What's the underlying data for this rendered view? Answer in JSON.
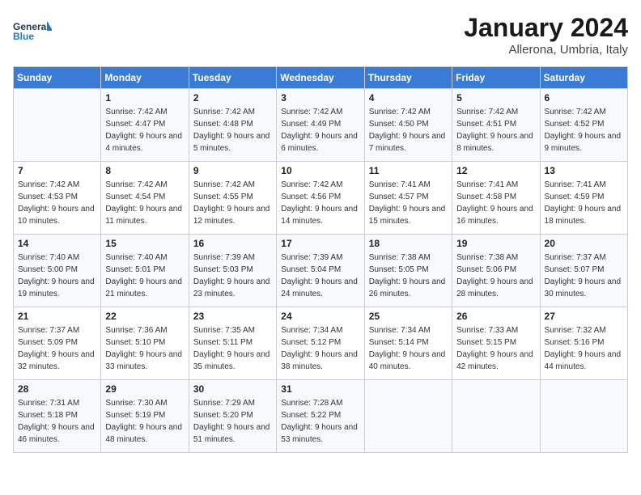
{
  "header": {
    "logo_line1": "General",
    "logo_line2": "Blue",
    "month_year": "January 2024",
    "location": "Allerona, Umbria, Italy"
  },
  "weekdays": [
    "Sunday",
    "Monday",
    "Tuesday",
    "Wednesday",
    "Thursday",
    "Friday",
    "Saturday"
  ],
  "weeks": [
    [
      {
        "day": "",
        "sunrise": "",
        "sunset": "",
        "daylight": ""
      },
      {
        "day": "1",
        "sunrise": "Sunrise: 7:42 AM",
        "sunset": "Sunset: 4:47 PM",
        "daylight": "Daylight: 9 hours and 4 minutes."
      },
      {
        "day": "2",
        "sunrise": "Sunrise: 7:42 AM",
        "sunset": "Sunset: 4:48 PM",
        "daylight": "Daylight: 9 hours and 5 minutes."
      },
      {
        "day": "3",
        "sunrise": "Sunrise: 7:42 AM",
        "sunset": "Sunset: 4:49 PM",
        "daylight": "Daylight: 9 hours and 6 minutes."
      },
      {
        "day": "4",
        "sunrise": "Sunrise: 7:42 AM",
        "sunset": "Sunset: 4:50 PM",
        "daylight": "Daylight: 9 hours and 7 minutes."
      },
      {
        "day": "5",
        "sunrise": "Sunrise: 7:42 AM",
        "sunset": "Sunset: 4:51 PM",
        "daylight": "Daylight: 9 hours and 8 minutes."
      },
      {
        "day": "6",
        "sunrise": "Sunrise: 7:42 AM",
        "sunset": "Sunset: 4:52 PM",
        "daylight": "Daylight: 9 hours and 9 minutes."
      }
    ],
    [
      {
        "day": "7",
        "sunrise": "Sunrise: 7:42 AM",
        "sunset": "Sunset: 4:53 PM",
        "daylight": "Daylight: 9 hours and 10 minutes."
      },
      {
        "day": "8",
        "sunrise": "Sunrise: 7:42 AM",
        "sunset": "Sunset: 4:54 PM",
        "daylight": "Daylight: 9 hours and 11 minutes."
      },
      {
        "day": "9",
        "sunrise": "Sunrise: 7:42 AM",
        "sunset": "Sunset: 4:55 PM",
        "daylight": "Daylight: 9 hours and 12 minutes."
      },
      {
        "day": "10",
        "sunrise": "Sunrise: 7:42 AM",
        "sunset": "Sunset: 4:56 PM",
        "daylight": "Daylight: 9 hours and 14 minutes."
      },
      {
        "day": "11",
        "sunrise": "Sunrise: 7:41 AM",
        "sunset": "Sunset: 4:57 PM",
        "daylight": "Daylight: 9 hours and 15 minutes."
      },
      {
        "day": "12",
        "sunrise": "Sunrise: 7:41 AM",
        "sunset": "Sunset: 4:58 PM",
        "daylight": "Daylight: 9 hours and 16 minutes."
      },
      {
        "day": "13",
        "sunrise": "Sunrise: 7:41 AM",
        "sunset": "Sunset: 4:59 PM",
        "daylight": "Daylight: 9 hours and 18 minutes."
      }
    ],
    [
      {
        "day": "14",
        "sunrise": "Sunrise: 7:40 AM",
        "sunset": "Sunset: 5:00 PM",
        "daylight": "Daylight: 9 hours and 19 minutes."
      },
      {
        "day": "15",
        "sunrise": "Sunrise: 7:40 AM",
        "sunset": "Sunset: 5:01 PM",
        "daylight": "Daylight: 9 hours and 21 minutes."
      },
      {
        "day": "16",
        "sunrise": "Sunrise: 7:39 AM",
        "sunset": "Sunset: 5:03 PM",
        "daylight": "Daylight: 9 hours and 23 minutes."
      },
      {
        "day": "17",
        "sunrise": "Sunrise: 7:39 AM",
        "sunset": "Sunset: 5:04 PM",
        "daylight": "Daylight: 9 hours and 24 minutes."
      },
      {
        "day": "18",
        "sunrise": "Sunrise: 7:38 AM",
        "sunset": "Sunset: 5:05 PM",
        "daylight": "Daylight: 9 hours and 26 minutes."
      },
      {
        "day": "19",
        "sunrise": "Sunrise: 7:38 AM",
        "sunset": "Sunset: 5:06 PM",
        "daylight": "Daylight: 9 hours and 28 minutes."
      },
      {
        "day": "20",
        "sunrise": "Sunrise: 7:37 AM",
        "sunset": "Sunset: 5:07 PM",
        "daylight": "Daylight: 9 hours and 30 minutes."
      }
    ],
    [
      {
        "day": "21",
        "sunrise": "Sunrise: 7:37 AM",
        "sunset": "Sunset: 5:09 PM",
        "daylight": "Daylight: 9 hours and 32 minutes."
      },
      {
        "day": "22",
        "sunrise": "Sunrise: 7:36 AM",
        "sunset": "Sunset: 5:10 PM",
        "daylight": "Daylight: 9 hours and 33 minutes."
      },
      {
        "day": "23",
        "sunrise": "Sunrise: 7:35 AM",
        "sunset": "Sunset: 5:11 PM",
        "daylight": "Daylight: 9 hours and 35 minutes."
      },
      {
        "day": "24",
        "sunrise": "Sunrise: 7:34 AM",
        "sunset": "Sunset: 5:12 PM",
        "daylight": "Daylight: 9 hours and 38 minutes."
      },
      {
        "day": "25",
        "sunrise": "Sunrise: 7:34 AM",
        "sunset": "Sunset: 5:14 PM",
        "daylight": "Daylight: 9 hours and 40 minutes."
      },
      {
        "day": "26",
        "sunrise": "Sunrise: 7:33 AM",
        "sunset": "Sunset: 5:15 PM",
        "daylight": "Daylight: 9 hours and 42 minutes."
      },
      {
        "day": "27",
        "sunrise": "Sunrise: 7:32 AM",
        "sunset": "Sunset: 5:16 PM",
        "daylight": "Daylight: 9 hours and 44 minutes."
      }
    ],
    [
      {
        "day": "28",
        "sunrise": "Sunrise: 7:31 AM",
        "sunset": "Sunset: 5:18 PM",
        "daylight": "Daylight: 9 hours and 46 minutes."
      },
      {
        "day": "29",
        "sunrise": "Sunrise: 7:30 AM",
        "sunset": "Sunset: 5:19 PM",
        "daylight": "Daylight: 9 hours and 48 minutes."
      },
      {
        "day": "30",
        "sunrise": "Sunrise: 7:29 AM",
        "sunset": "Sunset: 5:20 PM",
        "daylight": "Daylight: 9 hours and 51 minutes."
      },
      {
        "day": "31",
        "sunrise": "Sunrise: 7:28 AM",
        "sunset": "Sunset: 5:22 PM",
        "daylight": "Daylight: 9 hours and 53 minutes."
      },
      {
        "day": "",
        "sunrise": "",
        "sunset": "",
        "daylight": ""
      },
      {
        "day": "",
        "sunrise": "",
        "sunset": "",
        "daylight": ""
      },
      {
        "day": "",
        "sunrise": "",
        "sunset": "",
        "daylight": ""
      }
    ]
  ]
}
